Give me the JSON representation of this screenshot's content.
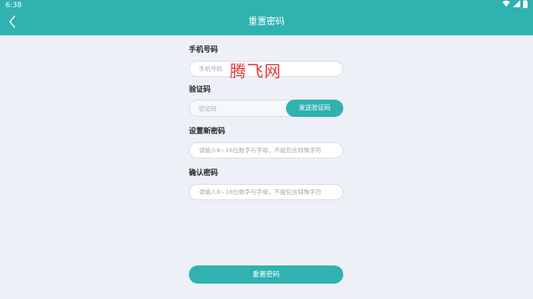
{
  "status_bar": {
    "time": "6:38",
    "icons": [
      "wifi-icon",
      "signal-icon",
      "battery-icon"
    ]
  },
  "header": {
    "title": "重置密码",
    "back_icon": "chevron-left-icon"
  },
  "form": {
    "phone": {
      "label": "手机号码",
      "placeholder": "手机号码",
      "value": ""
    },
    "code": {
      "label": "验证码",
      "placeholder": "验证码",
      "value": "",
      "button_label": "发送验证码"
    },
    "new_password": {
      "label": "设置新密码",
      "placeholder": "请输入8~16位数字与字母，不能包含特殊字符",
      "value": ""
    },
    "confirm_password": {
      "label": "确认密码",
      "placeholder": "请输入8~16位数字与字母，不能包含特殊字符",
      "value": ""
    }
  },
  "submit_label": "重置密码",
  "watermark": "腾飞网",
  "colors": {
    "accent": "#2fb2b0",
    "background": "#eef0f7",
    "watermark": "#e03a3a"
  }
}
